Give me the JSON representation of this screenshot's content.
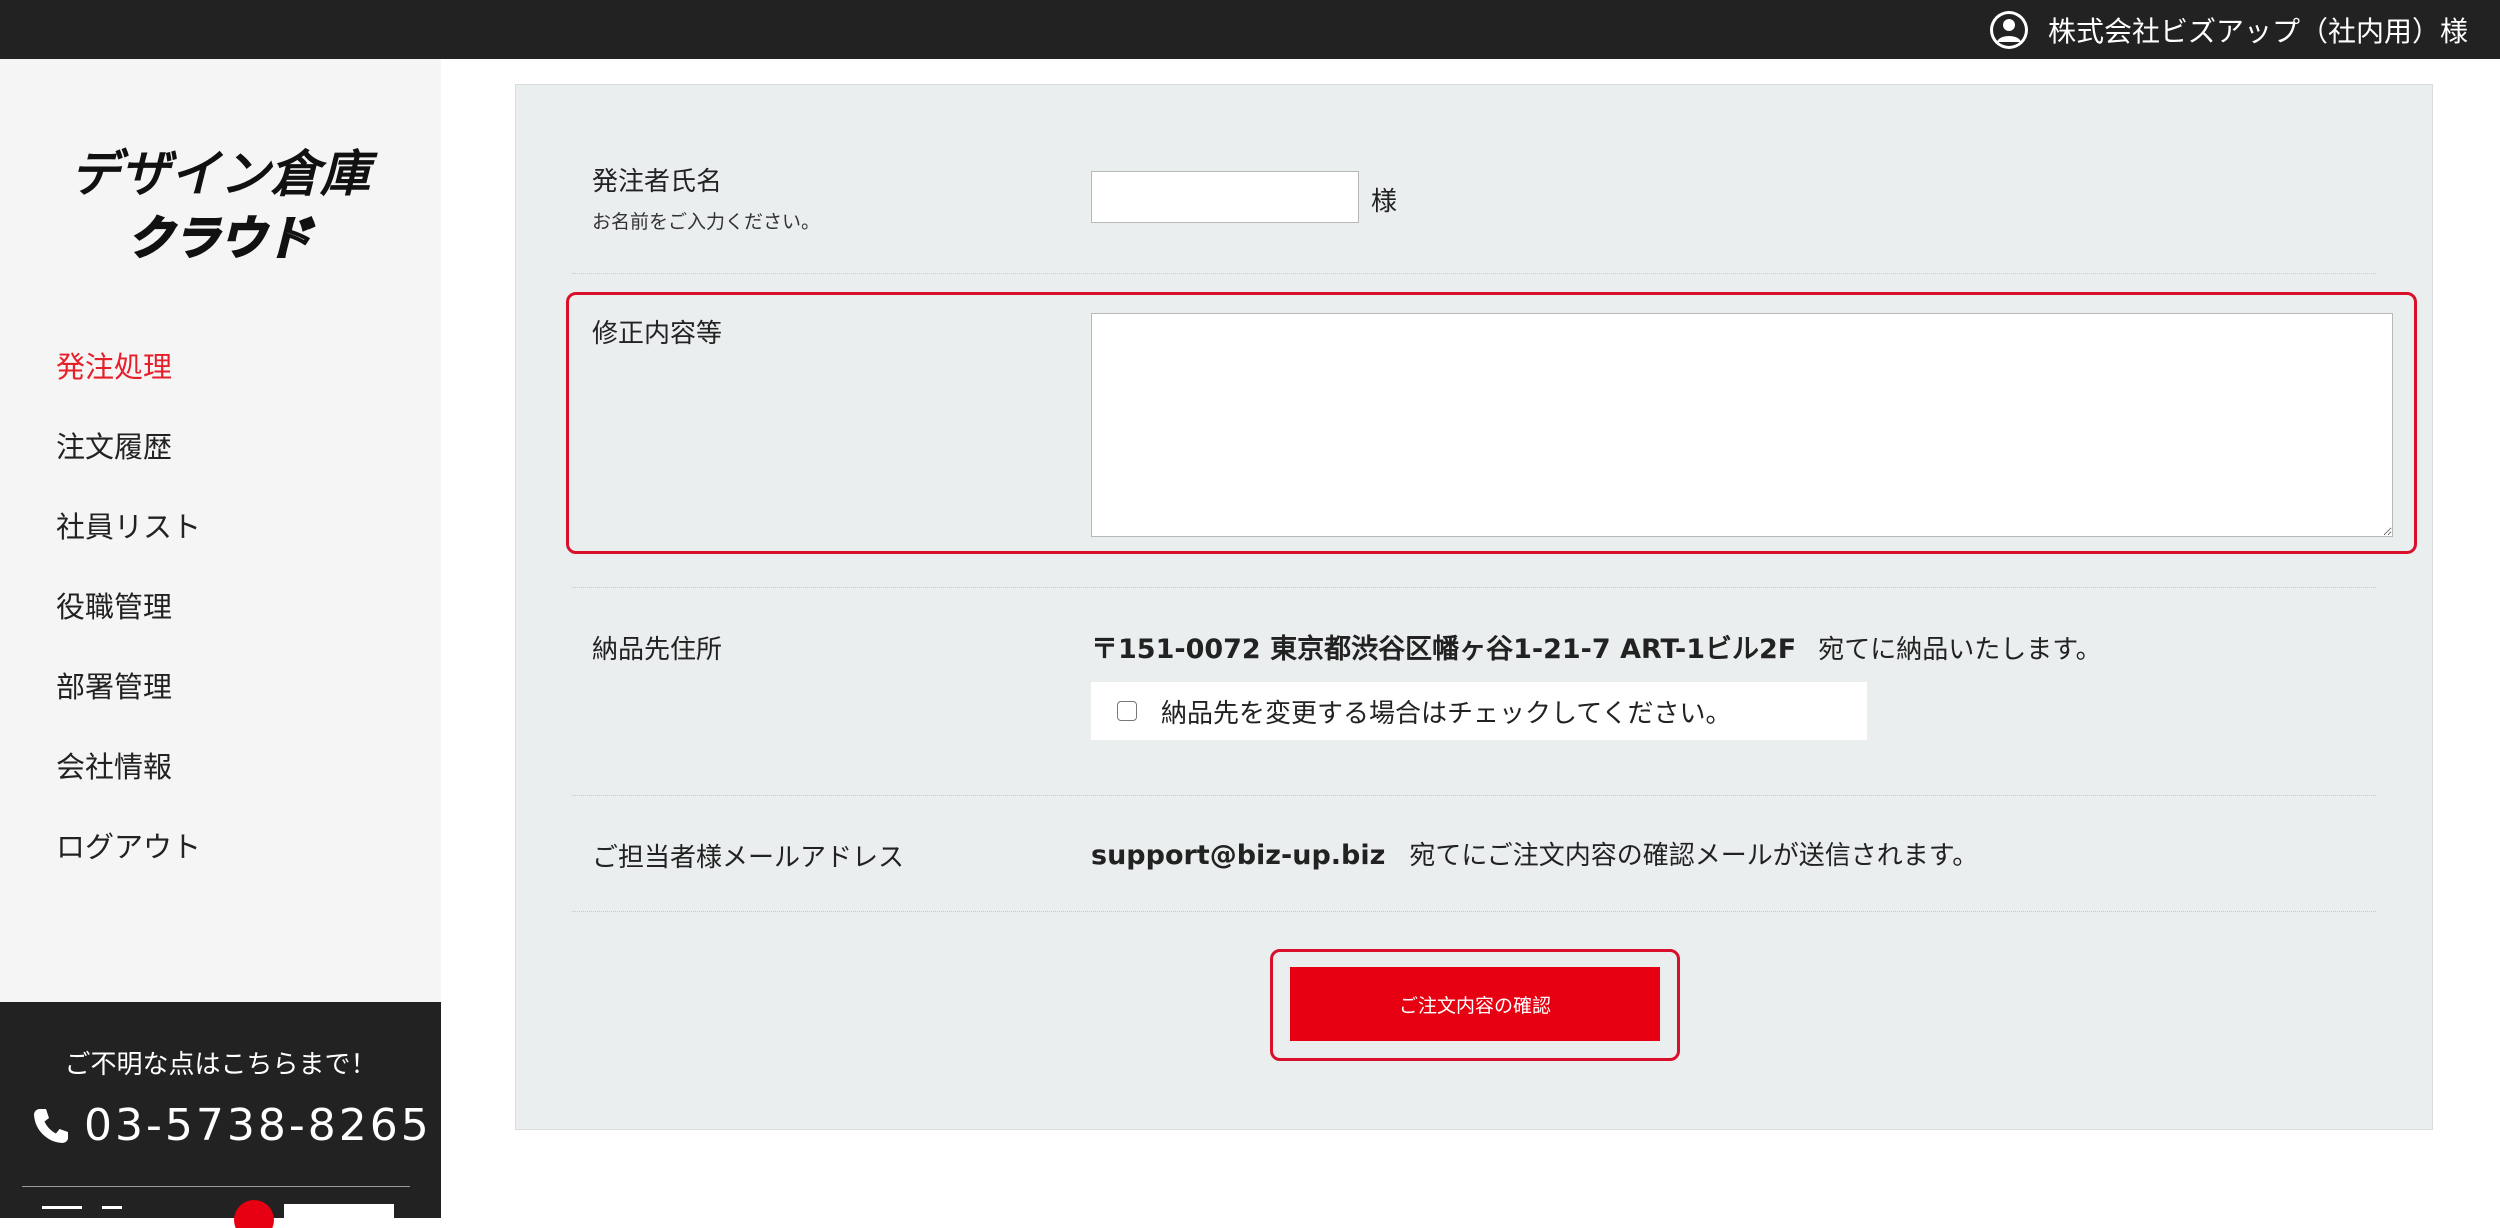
{
  "header": {
    "user_name": "株式会社ビズアップ（社内用）様"
  },
  "sidebar": {
    "logo_text_line1": "デザイン倉庫",
    "logo_text_line2": "クラウド",
    "nav": [
      {
        "label": "発注処理",
        "active": true
      },
      {
        "label": "注文履歴",
        "active": false
      },
      {
        "label": "社員リスト",
        "active": false
      },
      {
        "label": "役職管理",
        "active": false
      },
      {
        "label": "部署管理",
        "active": false
      },
      {
        "label": "会社情報",
        "active": false
      },
      {
        "label": "ログアウト",
        "active": false
      }
    ],
    "contact": {
      "question": "ご不明な点はこちらまで！",
      "phone": "03-5738-8265"
    }
  },
  "form": {
    "orderer": {
      "label": "発注者氏名",
      "sublabel": "お名前をご入力ください。",
      "value": "",
      "suffix": "様"
    },
    "revision": {
      "label": "修正内容等",
      "value": ""
    },
    "delivery": {
      "label": "納品先住所",
      "address": "〒151-0072 東京都渋谷区幡ヶ谷1-21-7 ART-1ビル2F",
      "suffix": "宛てに納品いたします。",
      "change_checkbox_label": "納品先を変更する場合はチェックしてください。",
      "change_checked": false
    },
    "email": {
      "label": "ご担当者様メールアドレス",
      "address": "support@biz-up.biz",
      "suffix": "宛てにご注文内容の確認メールが送信されます。"
    },
    "confirm_button": "ご注文内容の確認"
  },
  "colors": {
    "accent_red": "#e60012",
    "highlight_outline": "#d8102a",
    "topbar": "#222222",
    "panel_bg": "#ebeeef"
  }
}
